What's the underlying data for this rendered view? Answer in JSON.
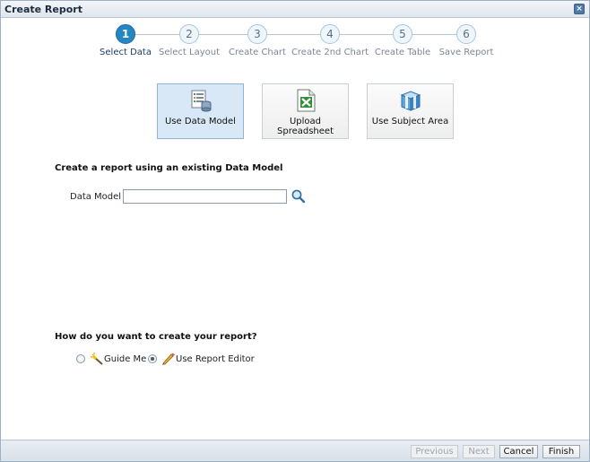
{
  "dialog": {
    "title": "Create Report",
    "close_label": "×"
  },
  "train": {
    "steps": [
      {
        "num": "1",
        "label": "Select Data",
        "active": true
      },
      {
        "num": "2",
        "label": "Select Layout"
      },
      {
        "num": "3",
        "label": "Create Chart"
      },
      {
        "num": "4",
        "label": "Create 2nd Chart"
      },
      {
        "num": "5",
        "label": "Create Table"
      },
      {
        "num": "6",
        "label": "Save Report"
      }
    ]
  },
  "sources": [
    {
      "label": "Use Data Model",
      "icon": "data-model-icon",
      "selected": true
    },
    {
      "label": "Upload Spreadsheet",
      "icon": "excel-icon"
    },
    {
      "label": "Use Subject Area",
      "icon": "subject-area-icon"
    }
  ],
  "data_model": {
    "heading": "Create a report using an existing Data Model",
    "field_label": "Data Model",
    "value": "",
    "search_icon": "magnifier-icon"
  },
  "mode": {
    "heading": "How do you want to create your report?",
    "options": [
      {
        "label": "Guide Me",
        "icon": "wand-icon",
        "selected": false
      },
      {
        "label": "Use Report Editor",
        "icon": "pencil-icon",
        "selected": true
      }
    ]
  },
  "footer": {
    "previous": "Previous",
    "next": "Next",
    "cancel": "Cancel",
    "finish": "Finish"
  },
  "colors": {
    "accent": "#2686c4",
    "selected_bg": "#d8e8f6"
  }
}
